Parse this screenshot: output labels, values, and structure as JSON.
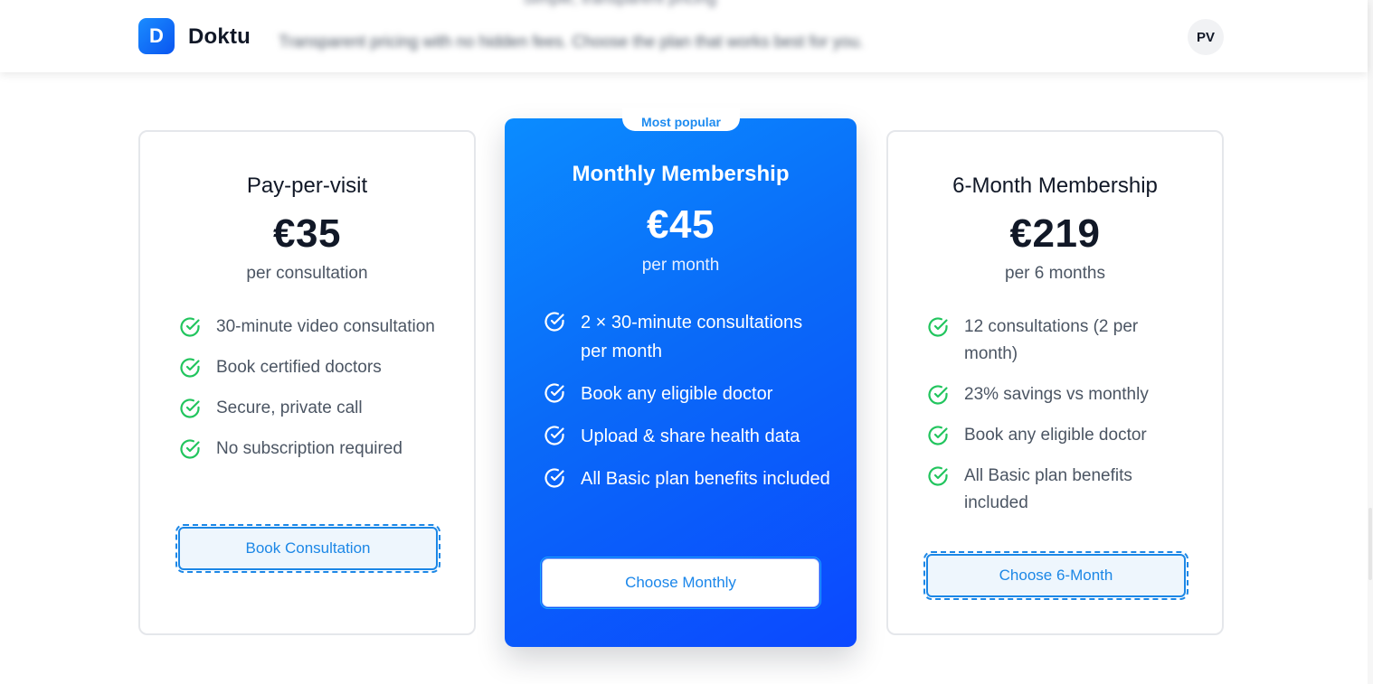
{
  "header": {
    "logo_letter": "D",
    "app_name": "Doktu",
    "avatar_initials": "PV",
    "blurred_heading": "Simple, transparent pricing",
    "blurred_subtitle": "Transparent pricing with no hidden fees. Choose the plan that works best for you."
  },
  "colors": {
    "brand_blue": "#0b6cf8",
    "check_green": "#22c55e",
    "button_blue": "#1c87e6"
  },
  "plans": [
    {
      "title": "Pay-per-visit",
      "price": "€35",
      "period": "per consultation",
      "features": [
        "30-minute video consultation",
        "Book certified doctors",
        "Secure, private call",
        "No subscription required"
      ],
      "button_label": "Book Consultation"
    },
    {
      "badge": "Most popular",
      "title": "Monthly Membership",
      "price": "€45",
      "period": "per month",
      "features": [
        "2 × 30-minute consultations per month",
        "Book any eligible doctor",
        "Upload & share health data",
        "All Basic plan benefits included"
      ],
      "button_label": "Choose Monthly"
    },
    {
      "title": "6-Month Membership",
      "price": "€219",
      "period": "per 6 months",
      "features": [
        "12 consultations (2 per month)",
        "23% savings vs monthly",
        "Book any eligible doctor",
        "All Basic plan benefits included"
      ],
      "button_label": "Choose 6-Month"
    }
  ]
}
